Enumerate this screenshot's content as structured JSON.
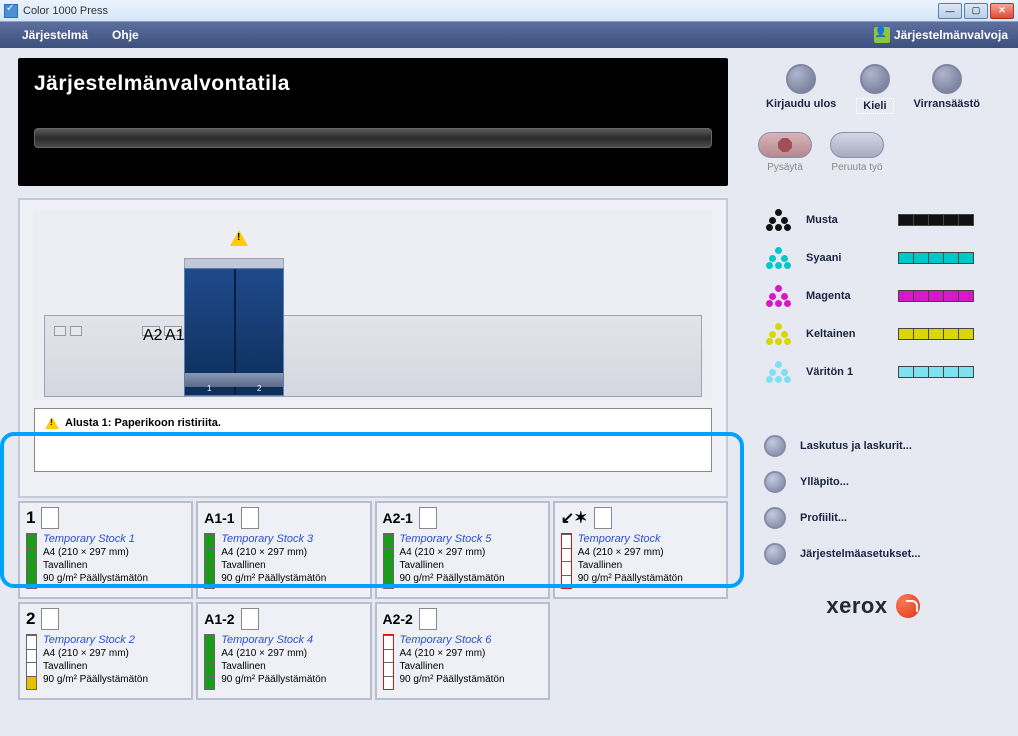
{
  "window": {
    "title": "Color 1000 Press"
  },
  "menu": {
    "system": "Järjestelmä",
    "help": "Ohje",
    "user": "Järjestelmänvalvoja"
  },
  "status": {
    "mode": "Järjestelmänvalvontatila"
  },
  "alert": {
    "text": "Alusta 1: Paperikoon ristiriita."
  },
  "topButtons": {
    "logout": "Kirjaudu ulos",
    "language": "Kieli",
    "powersave": "Virransäästö"
  },
  "actions": {
    "stop": "Pysäytä",
    "cancel": "Peruuta työ"
  },
  "toners": [
    {
      "name": "Musta",
      "color": "#111111"
    },
    {
      "name": "Syaani",
      "color": "#00c8c8"
    },
    {
      "name": "Magenta",
      "color": "#d818c8"
    },
    {
      "name": "Keltainen",
      "color": "#d8d800"
    },
    {
      "name": "Väritön 1",
      "color": "#7fe0f0"
    }
  ],
  "nav": [
    {
      "label": "Laskutus ja laskurit..."
    },
    {
      "label": "Ylläpito..."
    },
    {
      "label": "Profiilit..."
    },
    {
      "label": "Järjestelmäasetukset..."
    }
  ],
  "brand": "xerox",
  "trays": [
    {
      "id": "1",
      "stock": "Temporary Stock 1",
      "size": "A4 (210 × 297 mm)",
      "type": "Tavallinen",
      "weight": "90 g/m²  Päällystämätön",
      "level": 4,
      "levelColor": "green"
    },
    {
      "id": "A1-1",
      "stock": "Temporary Stock 3",
      "size": "A4 (210 × 297 mm)",
      "type": "Tavallinen",
      "weight": "90 g/m²  Päällystämätön",
      "level": 4,
      "levelColor": "green"
    },
    {
      "id": "A2-1",
      "stock": "Temporary Stock 5",
      "size": "A4 (210 × 297 mm)",
      "type": "Tavallinen",
      "weight": "90 g/m²  Päällystämätön",
      "level": 4,
      "levelColor": "green"
    },
    {
      "id": "bypass",
      "bypass": true,
      "stock": "Temporary Stock",
      "size": "A4 (210 × 297 mm)",
      "type": "Tavallinen",
      "weight": "90 g/m²  Päällystämätön",
      "level": 0,
      "levelColor": "red"
    },
    {
      "id": "2",
      "stock": "Temporary Stock 2",
      "size": "A4 (210 × 297 mm)",
      "type": "Tavallinen",
      "weight": "90 g/m²  Päällystämätön",
      "level": 1,
      "levelColor": "yellow"
    },
    {
      "id": "A1-2",
      "stock": "Temporary Stock 4",
      "size": "A4 (210 × 297 mm)",
      "type": "Tavallinen",
      "weight": "90 g/m²  Päällystämätön",
      "level": 4,
      "levelColor": "green"
    },
    {
      "id": "A2-2",
      "stock": "Temporary Stock 6",
      "size": "A4 (210 × 297 mm)",
      "type": "Tavallinen",
      "weight": "90 g/m²  Päällystämätön",
      "level": 0,
      "levelColor": "red"
    }
  ]
}
